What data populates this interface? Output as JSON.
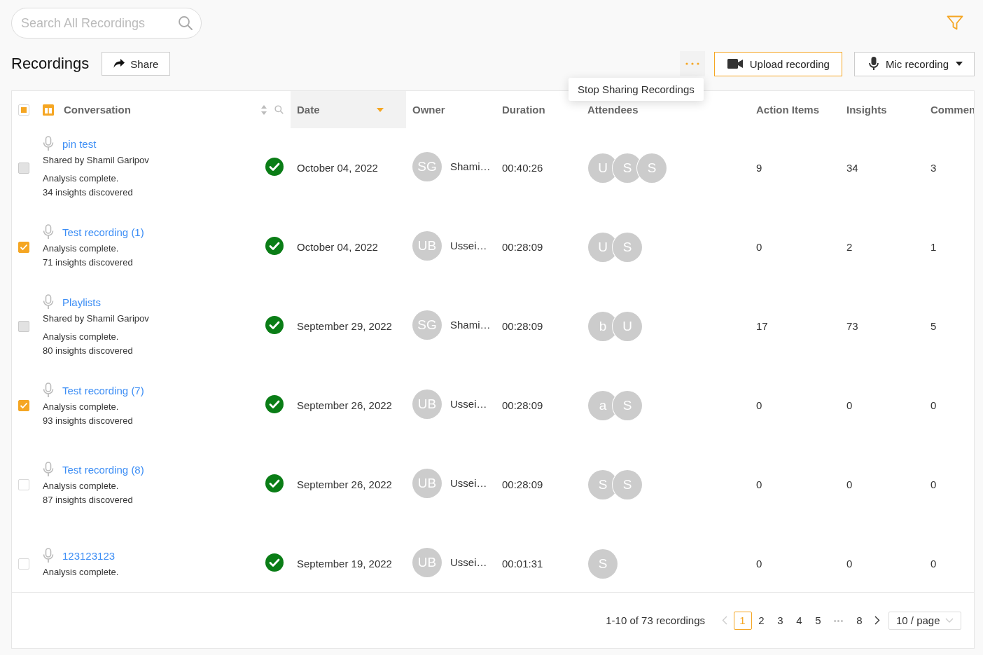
{
  "search": {
    "placeholder": "Search All Recordings"
  },
  "title": "Recordings",
  "share_button": "Share",
  "menu": {
    "items": [
      "Stop Sharing Recordings"
    ]
  },
  "upload_button": "Upload recording",
  "mic_button": "Mic recording",
  "table": {
    "select_all": {
      "indeterminate": true
    },
    "columns": [
      {
        "label": "Conversation",
        "kind": "conversation",
        "sorted": false
      },
      {
        "label": "Date",
        "kind": "text",
        "sorted": true
      },
      {
        "label": "Owner",
        "kind": "text",
        "sorted": false
      },
      {
        "label": "Duration",
        "kind": "text",
        "sorted": false
      },
      {
        "label": "Attendees",
        "kind": "text",
        "sorted": false
      },
      {
        "label": "Action Items",
        "kind": "text",
        "sorted": false
      },
      {
        "label": "Insights",
        "kind": "text",
        "sorted": false
      },
      {
        "label": "Commen",
        "kind": "text",
        "sorted": false
      }
    ],
    "rows": [
      {
        "title": "pin test",
        "shared_by": "Shared by Shamil Garipov",
        "lines": [
          "Analysis complete.",
          "34 insights discovered"
        ],
        "checked": false,
        "disabled": true,
        "analysis_done": true,
        "date": "October 04, 2022",
        "owner_initials": "SG",
        "owner": "Shami…",
        "duration": "00:40:26",
        "attendees": [
          "U",
          "S",
          "S"
        ],
        "action_items": "9",
        "insights": "34",
        "comments": "3"
      },
      {
        "title": "Test recording (1)",
        "lines": [
          "Analysis complete.",
          "71 insights discovered"
        ],
        "checked": true,
        "disabled": false,
        "analysis_done": true,
        "date": "October 04, 2022",
        "owner_initials": "UB",
        "owner": "Ussei…",
        "duration": "00:28:09",
        "attendees": [
          "U",
          "S"
        ],
        "action_items": "0",
        "insights": "2",
        "comments": "1"
      },
      {
        "title": "Playlists",
        "shared_by": "Shared by Shamil Garipov",
        "lines": [
          "Analysis complete.",
          "80 insights discovered"
        ],
        "checked": false,
        "disabled": true,
        "analysis_done": true,
        "date": "September 29, 2022",
        "owner_initials": "SG",
        "owner": "Shami…",
        "duration": "00:28:09",
        "attendees": [
          "b",
          "U"
        ],
        "action_items": "17",
        "insights": "73",
        "comments": "5"
      },
      {
        "title": "Test recording (7)",
        "lines": [
          "Analysis complete.",
          "93 insights discovered"
        ],
        "checked": true,
        "disabled": false,
        "analysis_done": true,
        "date": "September 26, 2022",
        "owner_initials": "UB",
        "owner": "Ussei…",
        "duration": "00:28:09",
        "attendees": [
          "a",
          "S"
        ],
        "action_items": "0",
        "insights": "0",
        "comments": "0"
      },
      {
        "title": "Test recording (8)",
        "lines": [
          "Analysis complete.",
          "87 insights discovered"
        ],
        "checked": false,
        "disabled": false,
        "analysis_done": true,
        "date": "September 26, 2022",
        "owner_initials": "UB",
        "owner": "Ussei…",
        "duration": "00:28:09",
        "attendees": [
          "S",
          "S"
        ],
        "action_items": "0",
        "insights": "0",
        "comments": "0"
      },
      {
        "title": "123123123",
        "lines": [
          "Analysis complete."
        ],
        "checked": false,
        "disabled": false,
        "analysis_done": true,
        "date": "September 19, 2022",
        "owner_initials": "UB",
        "owner": "Ussei…",
        "duration": "00:01:31",
        "attendees": [
          "S"
        ],
        "action_items": "0",
        "insights": "0",
        "comments": "0"
      }
    ]
  },
  "pagination": {
    "summary": "1-10 of 73 recordings",
    "prev_disabled": true,
    "pages": [
      {
        "label": "1",
        "kind": "page",
        "selected": true
      },
      {
        "label": "2",
        "kind": "page",
        "selected": false
      },
      {
        "label": "3",
        "kind": "page",
        "selected": false
      },
      {
        "label": "4",
        "kind": "page",
        "selected": false
      },
      {
        "label": "5",
        "kind": "page",
        "selected": false
      },
      {
        "label": "•••",
        "kind": "ellipsis",
        "selected": false
      },
      {
        "label": "8",
        "kind": "page",
        "selected": false
      }
    ],
    "page_size": "10 / page"
  }
}
